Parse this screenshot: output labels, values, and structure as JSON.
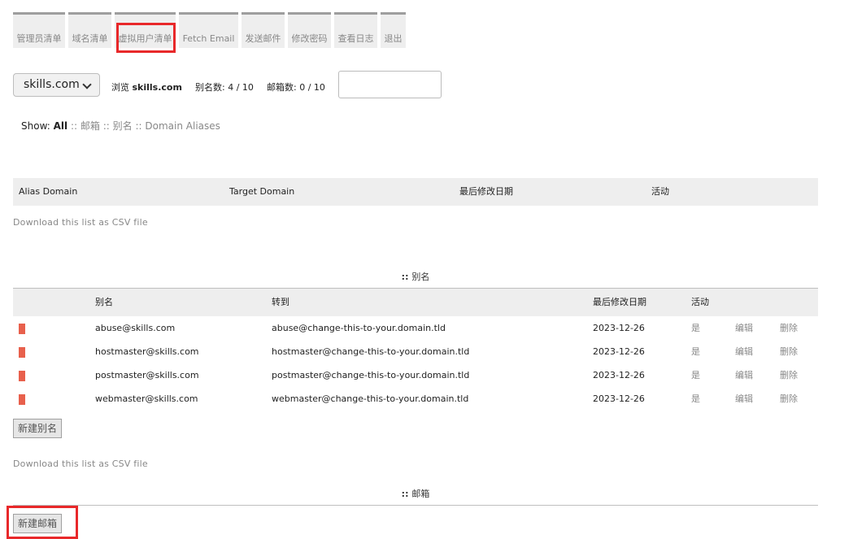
{
  "nav": {
    "tabs": [
      {
        "label": "管理员清单"
      },
      {
        "label": "域名清单"
      },
      {
        "label": "虚拟用户清单"
      },
      {
        "label": "Fetch Email"
      },
      {
        "label": "发送邮件"
      },
      {
        "label": "修改密码"
      },
      {
        "label": "查看日志"
      },
      {
        "label": "退出"
      }
    ]
  },
  "domain_bar": {
    "selected_domain": "skills.com",
    "browse_prefix": "浏览",
    "browse_domain": "skills.com",
    "alias_count": "别名数: 4 / 10",
    "mailbox_count": "邮箱数: 0 / 10",
    "search_value": ""
  },
  "show_filter": {
    "label": "Show:",
    "active": "All",
    "sep": "::",
    "options": [
      "邮箱",
      "别名",
      "Domain Aliases"
    ]
  },
  "domain_aliases_table": {
    "headers": [
      "Alias Domain",
      "Target Domain",
      "最后修改日期",
      "活动"
    ],
    "csv_link": "Download this list as CSV file"
  },
  "aliases_section": {
    "title_prefix": "::",
    "title": "别名",
    "headers": [
      "别名",
      "转到",
      "最后修改日期",
      "活动"
    ],
    "rows": [
      {
        "alias": "abuse@skills.com",
        "goto": "abuse@change-this-to-your.domain.tld",
        "modified": "2023-12-26",
        "active": "是",
        "edit": "编辑",
        "delete": "删除"
      },
      {
        "alias": "hostmaster@skills.com",
        "goto": "hostmaster@change-this-to-your.domain.tld",
        "modified": "2023-12-26",
        "active": "是",
        "edit": "编辑",
        "delete": "删除"
      },
      {
        "alias": "postmaster@skills.com",
        "goto": "postmaster@change-this-to-your.domain.tld",
        "modified": "2023-12-26",
        "active": "是",
        "edit": "编辑",
        "delete": "删除"
      },
      {
        "alias": "webmaster@skills.com",
        "goto": "webmaster@change-this-to-your.domain.tld",
        "modified": "2023-12-26",
        "active": "是",
        "edit": "编辑",
        "delete": "删除"
      }
    ],
    "new_button": "新建别名",
    "csv_link": "Download this list as CSV file"
  },
  "mailboxes_section": {
    "title_prefix": "::",
    "title": "邮箱",
    "new_button": "新建邮箱"
  },
  "colors": {
    "highlight": "#e8282a",
    "alias_flag": "#e8604c",
    "tab_bg": "#eeeeee",
    "tab_border": "#9e9e9e"
  }
}
